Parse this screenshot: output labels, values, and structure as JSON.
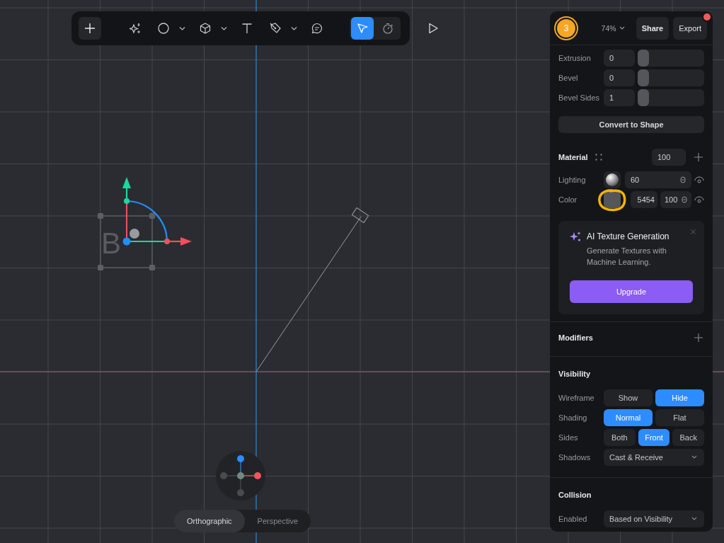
{
  "toolbar": {
    "groups": [
      {
        "tools": [
          {
            "kind": "add",
            "selected": false,
            "menu": false
          }
        ]
      },
      {
        "tools": [
          {
            "kind": "sparkle",
            "selected": false,
            "menu": false
          },
          {
            "kind": "ellipse",
            "selected": false,
            "menu": true
          },
          {
            "kind": "cube",
            "selected": false,
            "menu": true
          },
          {
            "kind": "text",
            "selected": false,
            "menu": false
          },
          {
            "kind": "pen",
            "selected": false,
            "menu": true
          },
          {
            "kind": "comment",
            "selected": false,
            "menu": false
          }
        ]
      },
      {
        "tools": [
          {
            "kind": "pointer",
            "selected": true,
            "menu": false
          },
          {
            "kind": "timer",
            "selected": false,
            "menu": false
          }
        ]
      },
      {
        "tools": [
          {
            "kind": "play",
            "selected": false,
            "menu": false
          }
        ]
      }
    ]
  },
  "canvas": {
    "object_label": "B"
  },
  "view_modes": [
    {
      "label": "Orthographic",
      "selected": true
    },
    {
      "label": "Perspective",
      "selected": false
    }
  ],
  "panel": {
    "header": {
      "badge": "3",
      "zoom": "74%",
      "share": "Share",
      "export": "Export",
      "export_notification": true
    },
    "geometry": [
      {
        "label": "Extrusion",
        "value": "0",
        "level": 0
      },
      {
        "label": "Bevel",
        "value": "0",
        "level": 0
      },
      {
        "label": "Bevel Sides",
        "value": "1",
        "level": 0
      }
    ],
    "convert_button": "Convert to Shape",
    "material": {
      "title": "Material",
      "opacity": "100",
      "lighting": {
        "label": "Lighting",
        "value": "60"
      },
      "color": {
        "label": "Color",
        "value": "5454",
        "opacity": "100"
      }
    },
    "promo": {
      "title": "AI Texture Generation",
      "text": "Generate Textures with Machine Learning.",
      "button": "Upgrade"
    },
    "modifiers": {
      "title": "Modifiers"
    },
    "visibility": {
      "title": "Visibility",
      "rows": [
        {
          "kind": "segmented",
          "label": "Wireframe",
          "options": [
            {
              "label": "Show",
              "selected": false
            },
            {
              "label": "Hide",
              "selected": true
            }
          ]
        },
        {
          "kind": "segmented",
          "label": "Shading",
          "options": [
            {
              "label": "Normal",
              "selected": true
            },
            {
              "label": "Flat",
              "selected": false
            }
          ]
        },
        {
          "kind": "segmented",
          "label": "Sides",
          "options": [
            {
              "label": "Both",
              "selected": false
            },
            {
              "label": "Front",
              "selected": true
            },
            {
              "label": "Back",
              "selected": false
            }
          ]
        },
        {
          "kind": "select",
          "label": "Shadows",
          "value": "Cast & Receive"
        }
      ]
    },
    "collision": {
      "title": "Collision",
      "rows": [
        {
          "kind": "select",
          "label": "Enabled",
          "value": "Based on Visibility"
        }
      ]
    }
  }
}
